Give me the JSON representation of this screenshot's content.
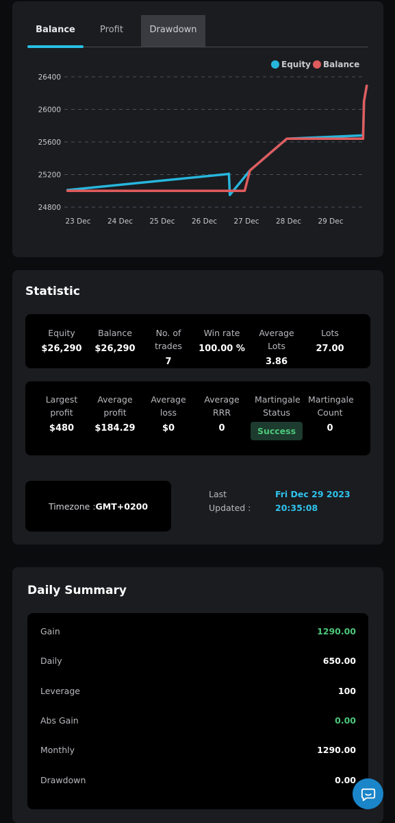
{
  "tabs": [
    {
      "label": "Balance",
      "active": true
    },
    {
      "label": "Profit",
      "active": false
    },
    {
      "label": "Drawdown",
      "active": false
    }
  ],
  "colors": {
    "equity": "#27b6dc",
    "balance": "#e05b5c",
    "accent": "#27bfe6",
    "success": "#4cc77a"
  },
  "chart_data": {
    "type": "line",
    "legend_position": "top-right",
    "grid": true,
    "ylim": [
      24800,
      26400
    ],
    "yticks": [
      26400,
      26000,
      25600,
      25200,
      24800
    ],
    "xticks": [
      "23 Dec",
      "24 Dec",
      "25 Dec",
      "26 Dec",
      "27 Dec",
      "28 Dec",
      "29 Dec"
    ],
    "x_range": [
      "2023-12-22T18:00",
      "2023-12-29T20:35"
    ],
    "series": [
      {
        "name": "Equity",
        "color": "#27b6dc",
        "points": [
          [
            "2023-12-22T18:00",
            25010
          ],
          [
            "2023-12-26T13:00",
            25205
          ],
          [
            "2023-12-26T14:00",
            25210
          ],
          [
            "2023-12-26T14:30",
            24950
          ],
          [
            "2023-12-27T02:00",
            25250
          ],
          [
            "2023-12-27T23:00",
            25640
          ],
          [
            "2023-12-29T18:00",
            25680
          ],
          [
            "2023-12-29T18:30",
            25690
          ],
          [
            "2023-12-29T19:00",
            26100
          ],
          [
            "2023-12-29T20:35",
            26290
          ]
        ]
      },
      {
        "name": "Balance",
        "color": "#e05b5c",
        "points": [
          [
            "2023-12-22T18:00",
            25000
          ],
          [
            "2023-12-26T14:00",
            25000
          ],
          [
            "2023-12-26T23:00",
            25000
          ],
          [
            "2023-12-27T02:00",
            25250
          ],
          [
            "2023-12-27T23:00",
            25640
          ],
          [
            "2023-12-29T18:30",
            25640
          ],
          [
            "2023-12-29T19:00",
            26100
          ],
          [
            "2023-12-29T20:35",
            26290
          ]
        ]
      }
    ]
  },
  "statistic": {
    "title": "Statistic",
    "row1": [
      {
        "label": "Equity",
        "value": "$26,290"
      },
      {
        "label": "Balance",
        "value": "$26,290"
      },
      {
        "label": "No. of trades",
        "value": "7"
      },
      {
        "label": "Win rate",
        "value": "100.00 %"
      },
      {
        "label": "Average Lots",
        "value": "3.86"
      },
      {
        "label": "Lots",
        "value": "27.00"
      }
    ],
    "row2": [
      {
        "label": "Largest profit",
        "value": "$480"
      },
      {
        "label": "Average profit",
        "value": "$184.29"
      },
      {
        "label": "Average loss",
        "value": "$0"
      },
      {
        "label": "Average RRR",
        "value": "0"
      },
      {
        "label": "Martingale Status",
        "value": "Success"
      },
      {
        "label": "Martingale Count",
        "value": "0"
      }
    ],
    "timezone_label": "Timezone :",
    "timezone_value": "GMT+0200",
    "last_updated_label": "Last Updated :",
    "last_updated_value": "Fri Dec 29 2023 20:35:08"
  },
  "daily": {
    "title": "Daily Summary",
    "rows": [
      {
        "label": "Gain",
        "value": "1290.00",
        "green": true
      },
      {
        "label": "Daily",
        "value": "650.00",
        "green": false
      },
      {
        "label": "Leverage",
        "value": "100",
        "green": false
      },
      {
        "label": "Abs Gain",
        "value": "0.00",
        "green": true
      },
      {
        "label": "Monthly",
        "value": "1290.00",
        "green": false
      },
      {
        "label": "Drawdown",
        "value": "0.00",
        "green": false
      }
    ]
  },
  "chat_icon": "chat-bubble-icon"
}
